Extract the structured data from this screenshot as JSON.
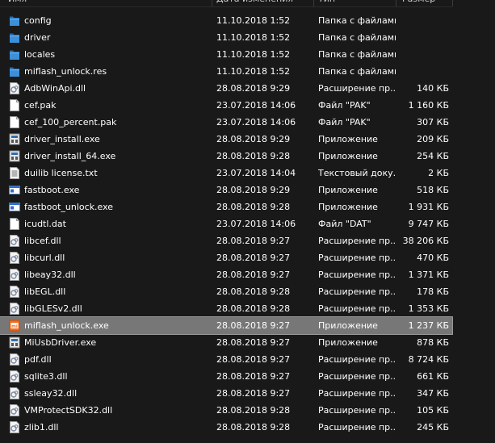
{
  "columns": {
    "name": "Имя",
    "date": "Дата изменения",
    "type": "Тип",
    "size": "Размер"
  },
  "files": [
    {
      "name": "config",
      "date": "11.10.2018 1:52",
      "type": "Папка с файлами",
      "size": "",
      "icon": "folder-icon"
    },
    {
      "name": "driver",
      "date": "11.10.2018 1:52",
      "type": "Папка с файлами",
      "size": "",
      "icon": "folder-icon"
    },
    {
      "name": "locales",
      "date": "11.10.2018 1:52",
      "type": "Папка с файлами",
      "size": "",
      "icon": "folder-icon"
    },
    {
      "name": "miflash_unlock.res",
      "date": "11.10.2018 1:52",
      "type": "Папка с файлами",
      "size": "",
      "icon": "folder-icon"
    },
    {
      "name": "AdbWinApi.dll",
      "date": "28.08.2018 9:29",
      "type": "Расширение пр...",
      "size": "140 КБ",
      "icon": "dll-file-icon"
    },
    {
      "name": "cef.pak",
      "date": "23.07.2018 14:06",
      "type": "Файл \"PAK\"",
      "size": "1 160 КБ",
      "icon": "blank-file-icon"
    },
    {
      "name": "cef_100_percent.pak",
      "date": "23.07.2018 14:06",
      "type": "Файл \"PAK\"",
      "size": "307 КБ",
      "icon": "blank-file-icon"
    },
    {
      "name": "driver_install.exe",
      "date": "28.08.2018 9:29",
      "type": "Приложение",
      "size": "209 КБ",
      "icon": "installer-icon"
    },
    {
      "name": "driver_install_64.exe",
      "date": "28.08.2018 9:28",
      "type": "Приложение",
      "size": "254 КБ",
      "icon": "installer-icon"
    },
    {
      "name": "duilib license.txt",
      "date": "23.07.2018 14:04",
      "type": "Текстовый доку...",
      "size": "2 КБ",
      "icon": "text-file-icon"
    },
    {
      "name": "fastboot.exe",
      "date": "28.08.2018 9:29",
      "type": "Приложение",
      "size": "518 КБ",
      "icon": "app-window-icon"
    },
    {
      "name": "fastboot_unlock.exe",
      "date": "28.08.2018 9:28",
      "type": "Приложение",
      "size": "1 931 КБ",
      "icon": "app-window-icon"
    },
    {
      "name": "icudtl.dat",
      "date": "23.07.2018 14:06",
      "type": "Файл \"DAT\"",
      "size": "9 747 КБ",
      "icon": "blank-file-icon"
    },
    {
      "name": "libcef.dll",
      "date": "28.08.2018 9:27",
      "type": "Расширение пр...",
      "size": "38 206 КБ",
      "icon": "dll-file-icon"
    },
    {
      "name": "libcurl.dll",
      "date": "28.08.2018 9:27",
      "type": "Расширение пр...",
      "size": "470 КБ",
      "icon": "dll-file-icon"
    },
    {
      "name": "libeay32.dll",
      "date": "28.08.2018 9:27",
      "type": "Расширение пр...",
      "size": "1 371 КБ",
      "icon": "dll-file-icon"
    },
    {
      "name": "libEGL.dll",
      "date": "28.08.2018 9:28",
      "type": "Расширение пр...",
      "size": "178 КБ",
      "icon": "dll-file-icon"
    },
    {
      "name": "libGLESv2.dll",
      "date": "28.08.2018 9:28",
      "type": "Расширение пр...",
      "size": "1 353 КБ",
      "icon": "dll-file-icon"
    },
    {
      "name": "miflash_unlock.exe",
      "date": "28.08.2018 9:27",
      "type": "Приложение",
      "size": "1 237 КБ",
      "icon": "mi-app-icon",
      "selected": true
    },
    {
      "name": "MiUsbDriver.exe",
      "date": "28.08.2018 9:27",
      "type": "Приложение",
      "size": "878 КБ",
      "icon": "installer-icon"
    },
    {
      "name": "pdf.dll",
      "date": "28.08.2018 9:27",
      "type": "Расширение пр...",
      "size": "8 724 КБ",
      "icon": "dll-file-icon"
    },
    {
      "name": "sqlite3.dll",
      "date": "28.08.2018 9:27",
      "type": "Расширение пр...",
      "size": "661 КБ",
      "icon": "dll-file-icon"
    },
    {
      "name": "ssleay32.dll",
      "date": "28.08.2018 9:27",
      "type": "Расширение пр...",
      "size": "347 КБ",
      "icon": "dll-file-icon"
    },
    {
      "name": "VMProtectSDK32.dll",
      "date": "28.08.2018 9:28",
      "type": "Расширение пр...",
      "size": "105 КБ",
      "icon": "dll-file-icon"
    },
    {
      "name": "zlib1.dll",
      "date": "28.08.2018 9:28",
      "type": "Расширение пр...",
      "size": "245 КБ",
      "icon": "dll-file-icon"
    }
  ],
  "colors": {
    "background": "#191919",
    "selected_row": "#777777",
    "folder": "#3c8fd8",
    "text": "#ffffff",
    "mi_orange": "#f36c21"
  }
}
